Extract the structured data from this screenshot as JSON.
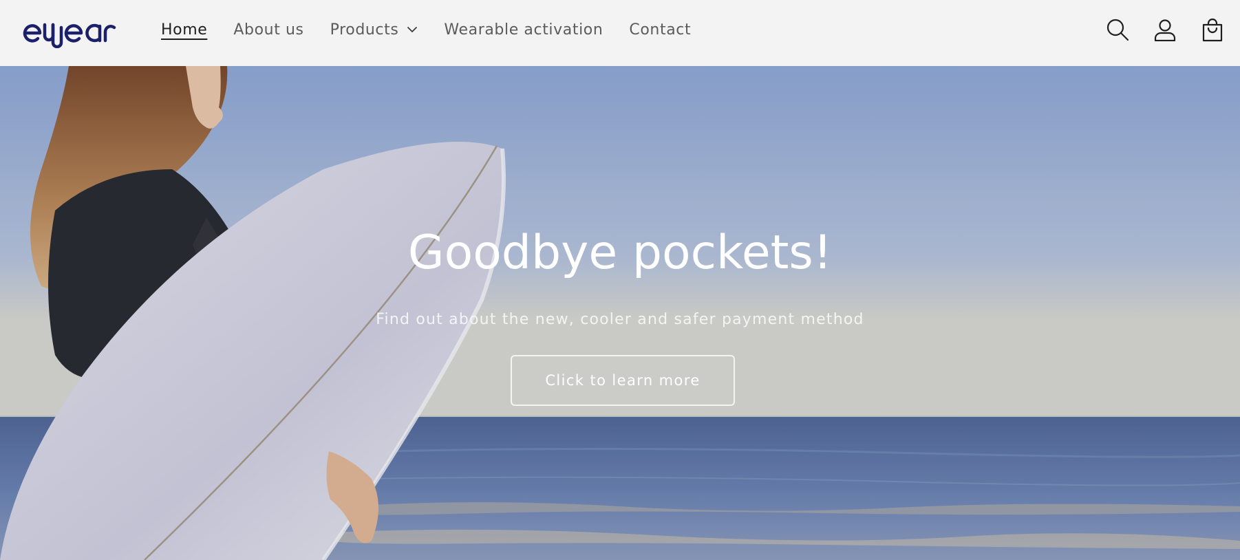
{
  "header": {
    "logo_text": "ewear",
    "nav": [
      {
        "label": "Home",
        "active": true
      },
      {
        "label": "About us",
        "active": false
      },
      {
        "label": "Products",
        "active": false,
        "has_dropdown": true
      },
      {
        "label": "Wearable activation",
        "active": false
      },
      {
        "label": "Contact",
        "active": false
      }
    ],
    "icons": [
      "search-icon",
      "account-icon",
      "cart-icon"
    ]
  },
  "hero": {
    "title": "Goodbye pockets!",
    "subtitle": "Find out about the new, cooler and safer payment method",
    "button_label": "Click to learn more"
  },
  "colors": {
    "brand": "#1b2068",
    "header_bg": "#f3f3f3",
    "nav_text": "#5b5b5b",
    "nav_active": "#1e1e1e",
    "sky_top": "#8fa9d6",
    "sea": "#5f7bb0"
  }
}
